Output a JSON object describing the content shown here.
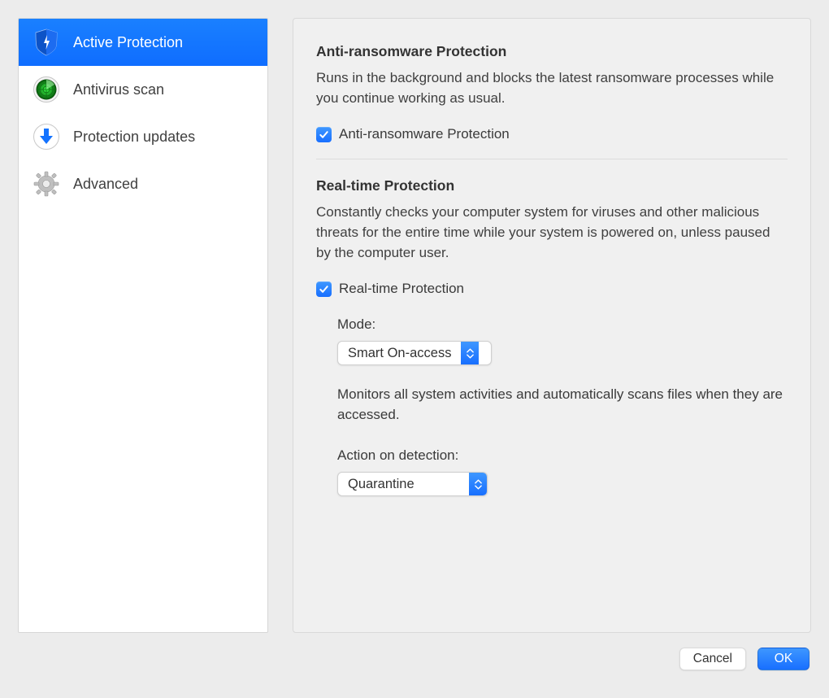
{
  "sidebar": {
    "items": [
      {
        "label": "Active Protection"
      },
      {
        "label": "Antivirus scan"
      },
      {
        "label": "Protection updates"
      },
      {
        "label": "Advanced"
      }
    ]
  },
  "main": {
    "anti_ransomware": {
      "title": "Anti-ransomware Protection",
      "desc": "Runs in the background and blocks the latest ransomware processes while you continue working as usual.",
      "check_label": "Anti-ransomware Protection"
    },
    "realtime": {
      "title": "Real-time Protection",
      "desc": "Constantly checks your computer system for viruses and other malicious threats for the entire time while your system is powered on, unless paused by the computer user.",
      "check_label": "Real-time Protection",
      "mode_label": "Mode:",
      "mode_value": "Smart On-access",
      "mode_desc": "Monitors all system activities and automatically scans files when they are accessed.",
      "action_label": "Action on detection:",
      "action_value": "Quarantine"
    }
  },
  "footer": {
    "cancel": "Cancel",
    "ok": "OK"
  }
}
